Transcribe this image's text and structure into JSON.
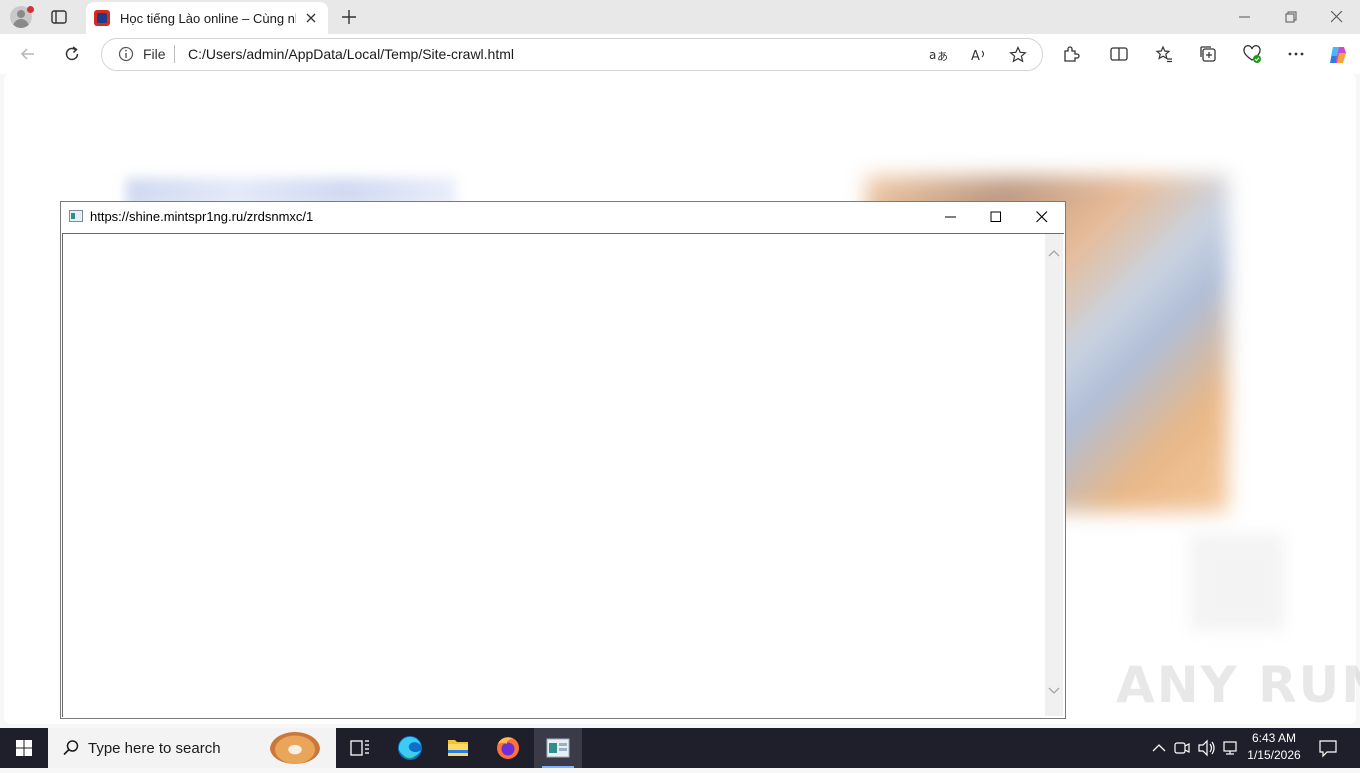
{
  "browser": {
    "tab": {
      "title": "Học tiếng Lào online – Cùng nhau",
      "favicon": "site-favicon"
    },
    "address_bar": {
      "scheme_label": "File",
      "url": "C:/Users/admin/AppData/Local/Temp/Site-crawl.html"
    },
    "toolbar_icons": [
      "back-icon",
      "refresh-icon",
      "translate-icon",
      "read-aloud-icon",
      "favorite-star-icon",
      "extensions-icon",
      "split-screen-icon",
      "favorites-icon",
      "collections-icon",
      "browser-essentials-icon",
      "more-icon",
      "copilot-icon"
    ],
    "window_controls": [
      "minimize-icon",
      "restore-icon",
      "close-icon"
    ]
  },
  "popup": {
    "title": "https://shine.mintspr1ng.ru/zrdsnmxc/1",
    "controls": [
      "minimize-icon",
      "maximize-icon",
      "close-icon"
    ]
  },
  "watermark": "ANY RUN",
  "taskbar": {
    "search_placeholder": "Type here to search",
    "apps": [
      "task-view-icon",
      "edge-icon",
      "file-explorer-icon",
      "firefox-icon",
      "active-window-icon"
    ],
    "tray_icons": [
      "chevron-up-icon",
      "meet-icon",
      "volume-icon",
      "network-icon",
      "notification-icon"
    ],
    "time": "6:43 AM",
    "date": "1/15/2026"
  },
  "colors": {
    "taskbar_bg": "#1f1f2b",
    "tabstrip_bg": "#e8e8e8",
    "accent": "#0078d4"
  }
}
